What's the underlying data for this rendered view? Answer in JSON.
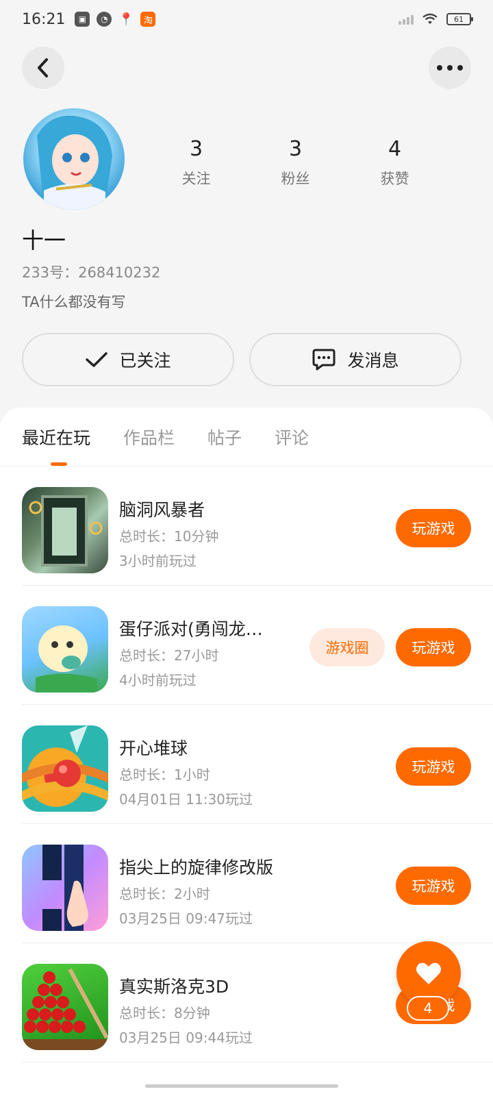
{
  "status_bar": {
    "time": "16:21",
    "battery": "61",
    "icons": [
      "app-icon",
      "speed-icon",
      "location-icon",
      "taobao-icon"
    ],
    "taobao_glyph": "淘"
  },
  "profile": {
    "name": "十一",
    "id_text": "233号：268410232",
    "bio": "TA什么都没有写",
    "stats": [
      {
        "value": "3",
        "label": "关注"
      },
      {
        "value": "3",
        "label": "粉丝"
      },
      {
        "value": "4",
        "label": "获赞"
      }
    ],
    "follow_label": "已关注",
    "message_label": "发消息"
  },
  "tabs": [
    {
      "label": "最近在玩",
      "active": true
    },
    {
      "label": "作品栏",
      "active": false
    },
    {
      "label": "帖子",
      "active": false
    },
    {
      "label": "评论",
      "active": false
    }
  ],
  "games": [
    {
      "title": "脑洞风暴者",
      "duration": "总时长：10分钟",
      "last_played": "3小时前玩过",
      "play_label": "玩游戏",
      "circle_label": ""
    },
    {
      "title": "蛋仔派对(勇闯龙…",
      "duration": "总时长：27小时",
      "last_played": "4小时前玩过",
      "play_label": "玩游戏",
      "circle_label": "游戏圈"
    },
    {
      "title": "开心堆球",
      "duration": "总时长：1小时",
      "last_played": "04月01日  11:30玩过",
      "play_label": "玩游戏",
      "circle_label": ""
    },
    {
      "title": "指尖上的旋律修改版",
      "duration": "总时长：2小时",
      "last_played": "03月25日  09:47玩过",
      "play_label": "玩游戏",
      "circle_label": ""
    },
    {
      "title": "真实斯洛克3D",
      "duration": "总时长：8分钟",
      "last_played": "03月25日  09:44玩过",
      "play_label": "玩游戏",
      "circle_label": ""
    }
  ],
  "like_fab": {
    "count": "4"
  },
  "colors": {
    "accent": "#ff6a00",
    "accent_light": "#ffe9de"
  }
}
